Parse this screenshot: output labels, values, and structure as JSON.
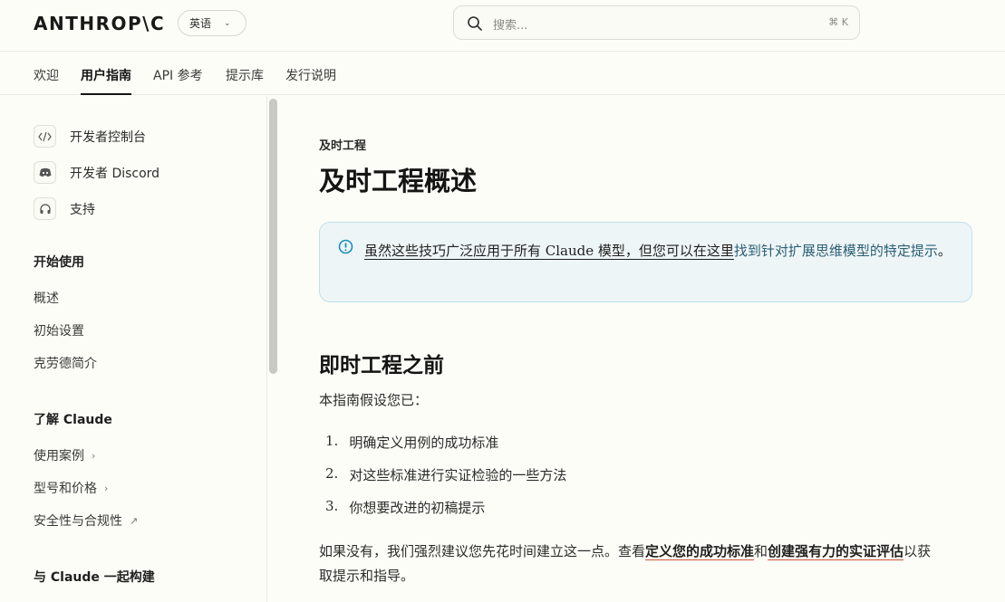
{
  "header": {
    "logo": "ANTHROP\\C",
    "language": "英语",
    "search_placeholder": "搜索...",
    "search_shortcut": "⌘ K"
  },
  "nav": {
    "tabs": [
      "欢迎",
      "用户指南",
      "API 参考",
      "提示库",
      "发行说明"
    ],
    "active": "用户指南"
  },
  "sidebar": {
    "links": [
      {
        "label": "开发者控制台",
        "icon": "code-icon"
      },
      {
        "label": "开发者 Discord",
        "icon": "discord-icon"
      },
      {
        "label": "支持",
        "icon": "headset-icon"
      }
    ],
    "sections": [
      {
        "heading": "开始使用",
        "items": [
          "概述",
          "初始设置",
          "克劳德简介"
        ]
      },
      {
        "heading": "了解 Claude",
        "items": [
          "使用案例",
          "型号和价格",
          "安全性与合规性"
        ]
      },
      {
        "heading": "与 Claude 一起构建",
        "items": []
      }
    ]
  },
  "main": {
    "breadcrumb": "及时工程",
    "title": "及时工程概述",
    "callout": {
      "underlined": "虽然这些技巧广泛应用于所有 Claude 模型，但您可以在这里",
      "link": "找到针对扩展思维模型的特定提示",
      "end": "。"
    },
    "section_title": "即时工程之前",
    "intro": "本指南假设您已：",
    "list": [
      "明确定义用例的成功标准",
      "对这些标准进行实证检验的一些方法",
      "你想要改进的初稿提示"
    ],
    "footer_text": {
      "part1": "如果没有，我们强烈建议您先花时间建立这一点。查看",
      "link1": "定义您的成功标准",
      "part2": "和",
      "link2": "创建强有力的实证评估",
      "part3": "以获",
      "line2": "取提示和指导。"
    }
  }
}
